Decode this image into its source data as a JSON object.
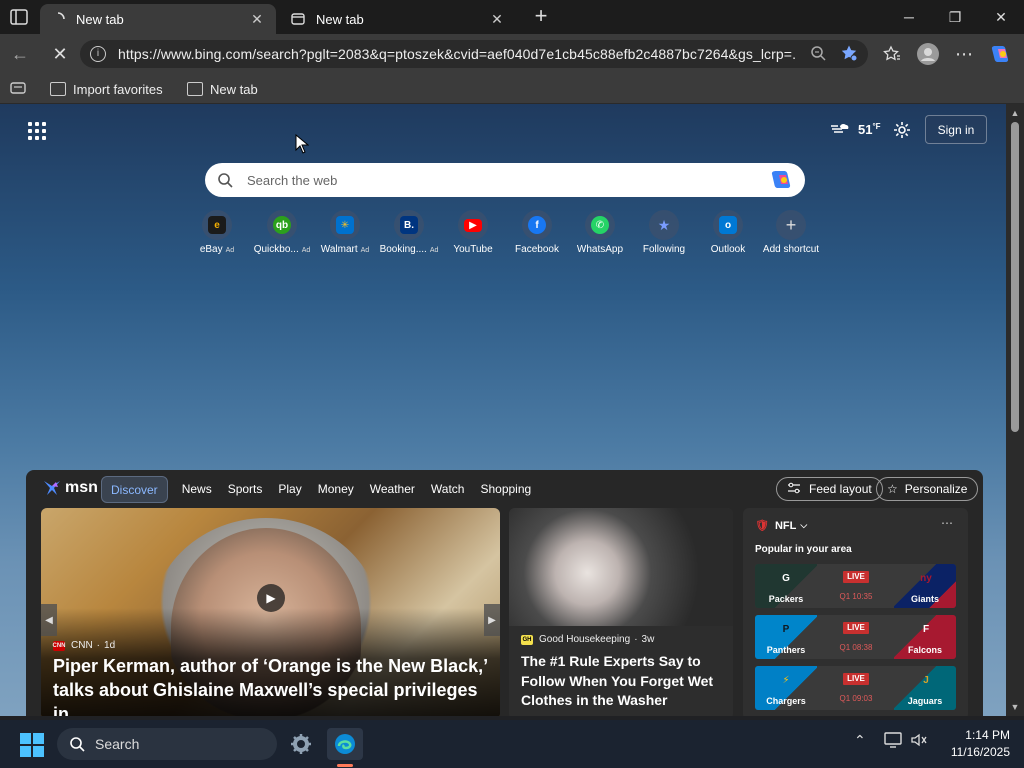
{
  "browser": {
    "tabs": [
      {
        "label": "New tab",
        "active": true
      },
      {
        "label": "New tab",
        "active": false
      }
    ],
    "address": "https://www.bing.com/search?pglt=2083&q=ptoszek&cvid=aef040d7e1cb45c88efb2c4887bc7264&gs_lcrp=..."
  },
  "favorites": {
    "import": "Import favorites",
    "newtab": "New tab"
  },
  "top": {
    "temperature": "51",
    "temp_unit": "°F",
    "signin": "Sign in"
  },
  "search": {
    "placeholder": "Search the web"
  },
  "shortcuts": [
    {
      "name": "eBay",
      "ad": "Ad",
      "icon": "ebay-icon",
      "color": "#f5af02"
    },
    {
      "name": "Quickbo...",
      "ad": "Ad",
      "icon": "quickbooks-icon",
      "color": "#2ca01c"
    },
    {
      "name": "Walmart",
      "ad": "Ad",
      "icon": "walmart-icon",
      "color": "#0071ce"
    },
    {
      "name": "Booking....",
      "ad": "Ad",
      "icon": "booking-icon",
      "color": "#003580"
    },
    {
      "name": "YouTube",
      "ad": "",
      "icon": "youtube-icon",
      "color": "#ff0000"
    },
    {
      "name": "Facebook",
      "ad": "",
      "icon": "facebook-icon",
      "color": "#1877f2"
    },
    {
      "name": "WhatsApp",
      "ad": "",
      "icon": "whatsapp-icon",
      "color": "#25d366"
    },
    {
      "name": "Following",
      "ad": "",
      "icon": "following-icon",
      "color": "#4a6fd8"
    },
    {
      "name": "Outlook",
      "ad": "",
      "icon": "outlook-icon",
      "color": "#0078d4"
    },
    {
      "name": "Add shortcut",
      "ad": "",
      "icon": "plus-icon",
      "color": "#5f6f84"
    }
  ],
  "feed": {
    "logo": "msn",
    "nav": [
      "Discover",
      "News",
      "Sports",
      "Play",
      "Money",
      "Weather",
      "Watch",
      "Shopping"
    ],
    "feed_layout": "Feed layout",
    "personalize": "Personalize",
    "hero": {
      "source": "CNN",
      "age": "1d",
      "headline_line1": "Piper Kerman, author of ‘Orange is the New Black,’",
      "headline_line2": "talks about Ghislaine Maxwell’s special privileges in..."
    },
    "card2": {
      "source": "Good Housekeeping",
      "age": "3w",
      "headline_line1": "The #1 Rule Experts Say to",
      "headline_line2": "Follow When You Forget Wet",
      "headline_line3": "Clothes in the Washer"
    },
    "nfl": {
      "title": "NFL",
      "subtitle": "Popular in your area",
      "games": [
        {
          "home": "Packers",
          "away": "Giants",
          "status": "LIVE",
          "clock": "Q1 10:35",
          "home_color": "#203731",
          "away_color": "#0b2265"
        },
        {
          "home": "Panthers",
          "away": "Falcons",
          "status": "LIVE",
          "clock": "Q1 08:38",
          "home_color": "#0085ca",
          "away_color": "#a71930"
        },
        {
          "home": "Chargers",
          "away": "Jaguars",
          "status": "LIVE",
          "clock": "Q1 09:03",
          "home_color": "#0080c6",
          "away_color": "#006778"
        }
      ]
    }
  },
  "taskbar": {
    "search": "Search",
    "time": "1:14 PM",
    "date": "11/16/2025"
  }
}
